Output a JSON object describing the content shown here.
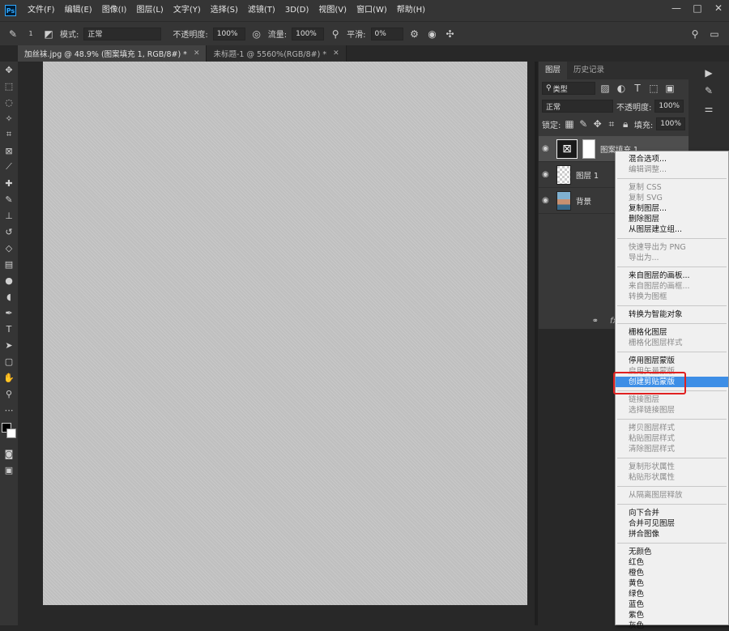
{
  "app": {
    "logo": "Ps"
  },
  "menu": [
    "文件(F)",
    "编辑(E)",
    "图像(I)",
    "图层(L)",
    "文字(Y)",
    "选择(S)",
    "滤镜(T)",
    "3D(D)",
    "视图(V)",
    "窗口(W)",
    "帮助(H)"
  ],
  "window_controls": {
    "minimize": "—",
    "restore": "□",
    "close": "✕"
  },
  "options": {
    "mode_label": "模式:",
    "mode_value": "正常",
    "opacity_label": "不透明度:",
    "opacity_value": "100%",
    "flow_label": "流量:",
    "flow_value": "100%",
    "smooth_label": "平滑:",
    "smooth_value": "0%",
    "brush_size": "1"
  },
  "tabs": [
    {
      "label": "加丝袜.jpg @ 48.9% (图案填充 1, RGB/8#) *",
      "close": "✕"
    },
    {
      "label": "未标题-1 @ 5560%(RGB/8#) *",
      "close": "✕"
    }
  ],
  "layers_panel": {
    "tabs": [
      "图层",
      "历史记录"
    ],
    "filter_label": "类型",
    "blend_mode": "正常",
    "opacity_label": "不透明度:",
    "opacity_value": "100%",
    "lock_label": "锁定:",
    "fill_label": "填充:",
    "fill_value": "100%",
    "layers": [
      {
        "name": "图案填充 1"
      },
      {
        "name": "图层 1"
      },
      {
        "name": "背景"
      }
    ]
  },
  "context_menu": {
    "groups": [
      [
        {
          "label": "混合选项...",
          "disabled": false
        },
        {
          "label": "编辑调整...",
          "disabled": true
        }
      ],
      [
        {
          "label": "复制 CSS",
          "disabled": true
        },
        {
          "label": "复制 SVG",
          "disabled": true
        },
        {
          "label": "复制图层...",
          "disabled": false
        },
        {
          "label": "删除图层",
          "disabled": false
        },
        {
          "label": "从图层建立组...",
          "disabled": false
        }
      ],
      [
        {
          "label": "快速导出为 PNG",
          "disabled": true
        },
        {
          "label": "导出为...",
          "disabled": true
        }
      ],
      [
        {
          "label": "来自图层的画板...",
          "disabled": false
        },
        {
          "label": "来自图层的画框...",
          "disabled": true
        },
        {
          "label": "转换为图框",
          "disabled": true
        }
      ],
      [
        {
          "label": "转换为智能对象",
          "disabled": false
        }
      ],
      [
        {
          "label": "栅格化图层",
          "disabled": false
        },
        {
          "label": "栅格化图层样式",
          "disabled": true
        }
      ],
      [
        {
          "label": "停用图层蒙版",
          "disabled": false
        },
        {
          "label": "启用矢量蒙版",
          "disabled": true
        },
        {
          "label": "创建剪贴蒙版",
          "disabled": false,
          "highlighted": true
        }
      ],
      [
        {
          "label": "链接图层",
          "disabled": true
        },
        {
          "label": "选择链接图层",
          "disabled": true
        }
      ],
      [
        {
          "label": "拷贝图层样式",
          "disabled": true
        },
        {
          "label": "粘贴图层样式",
          "disabled": true
        },
        {
          "label": "清除图层样式",
          "disabled": true
        }
      ],
      [
        {
          "label": "复制形状属性",
          "disabled": true
        },
        {
          "label": "粘贴形状属性",
          "disabled": true
        }
      ],
      [
        {
          "label": "从隔离图层释放",
          "disabled": true
        }
      ],
      [
        {
          "label": "向下合并",
          "disabled": false
        },
        {
          "label": "合并可见图层",
          "disabled": false
        },
        {
          "label": "拼合图像",
          "disabled": false
        }
      ],
      [
        {
          "label": "无颜色",
          "disabled": false
        },
        {
          "label": "红色",
          "disabled": false
        },
        {
          "label": "橙色",
          "disabled": false
        },
        {
          "label": "黄色",
          "disabled": false
        },
        {
          "label": "绿色",
          "disabled": false
        },
        {
          "label": "蓝色",
          "disabled": false
        },
        {
          "label": "紫色",
          "disabled": false
        },
        {
          "label": "灰色",
          "disabled": false
        }
      ]
    ]
  },
  "colors": {
    "highlight": "#3d8ee6",
    "annotation": "#e02020"
  }
}
